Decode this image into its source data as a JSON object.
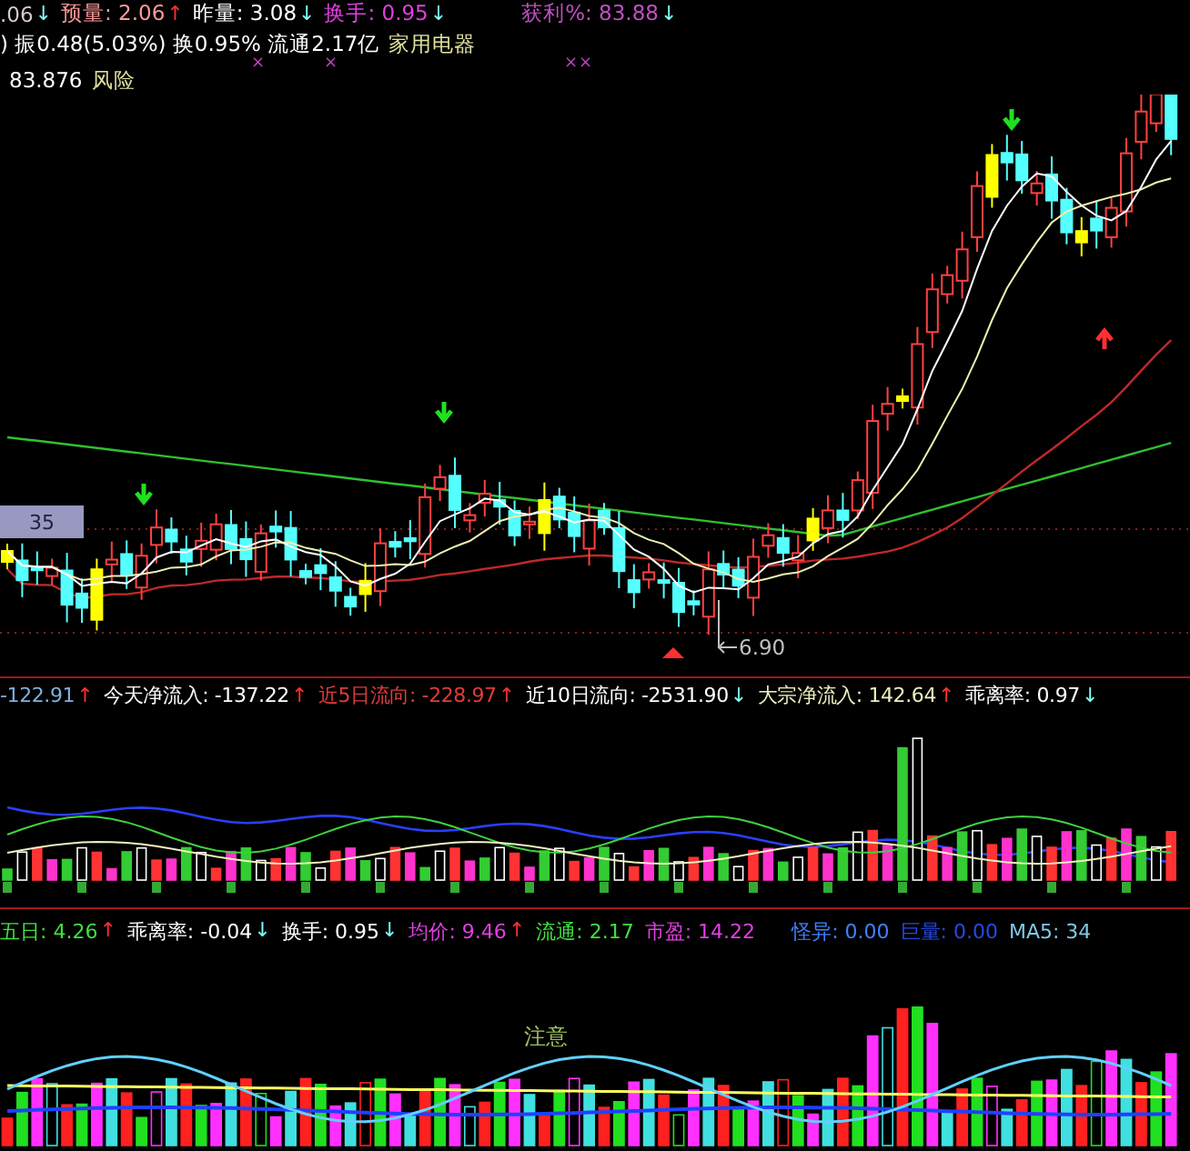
{
  "quote_header": {
    "row_1": [
      {
        "text": ".06",
        "color": "#d8c8c8",
        "rising": false,
        "arrow": "↓"
      },
      {
        "text": "预量: 2.06",
        "color": "#ff9c9c",
        "rising": true,
        "arrow": "↑"
      },
      {
        "text": "昨量: 3.08",
        "color": "#ffffff",
        "rising": false,
        "arrow": "↓"
      },
      {
        "text": "换手: 0.95",
        "color": "#e040e0",
        "rising": false,
        "arrow": "↓"
      },
      {
        "text": "获利%: 83.88",
        "color": "#c050c0",
        "rising": false,
        "arrow": "↓"
      }
    ],
    "row_2": [
      {
        "text": ") 振0.48(5.03%) 换0.95% 流通2.17亿",
        "color": "#ffffff"
      },
      {
        "text": "家用电器",
        "color": "#e0e0a0"
      }
    ],
    "row_3": [
      {
        "text": "83.876",
        "color": "#ffffff"
      },
      {
        "text": "风险",
        "color": "#e0e0a0"
      }
    ],
    "cross_marks": [
      "×",
      "×",
      "×",
      "×"
    ]
  },
  "price_chart": {
    "level_box": "35",
    "low_label": "6.90"
  },
  "flow_indicator": {
    "values": [
      {
        "text": "-122.91",
        "color": "#80b0e0",
        "rising": true,
        "arrow": "↑"
      },
      {
        "text": "今天净流入: -137.22",
        "color": "#ffffff",
        "rising": true,
        "arrow": "↑"
      },
      {
        "text": "近5日流向: -228.97",
        "color": "#e03c3c",
        "rising": true,
        "arrow": "↑"
      },
      {
        "text": "近10日流向: -2531.90",
        "color": "#ffffff",
        "rising": false,
        "arrow": "↓"
      },
      {
        "text": "大宗净流入: 142.64",
        "color": "#f0f0c0",
        "rising": true,
        "arrow": "↑"
      },
      {
        "text": "乖离率: 0.97",
        "color": "#ffffff",
        "rising": false,
        "arrow": "↓"
      }
    ]
  },
  "volume_indicator": {
    "values": [
      {
        "text": "五日: 4.26",
        "color": "#40e040",
        "rising": true,
        "arrow": "↑"
      },
      {
        "text": "乖离率: -0.04",
        "color": "#ffffff",
        "rising": false,
        "arrow": "↓"
      },
      {
        "text": "换手: 0.95",
        "color": "#ffffff",
        "rising": false,
        "arrow": "↓"
      },
      {
        "text": "均价: 9.46",
        "color": "#e040e0",
        "rising": true,
        "arrow": "↑"
      },
      {
        "text": "流通: 2.17",
        "color": "#40e040"
      },
      {
        "text": "市盈: 14.22",
        "color": "#e040e0"
      },
      {
        "text": "怪异: 0.00",
        "color": "#4080ff"
      },
      {
        "text": "巨量: 0.00",
        "color": "#2848e0"
      },
      {
        "text": "MA5: 34",
        "color": "#80c8e8"
      }
    ],
    "note": "注意"
  }
}
